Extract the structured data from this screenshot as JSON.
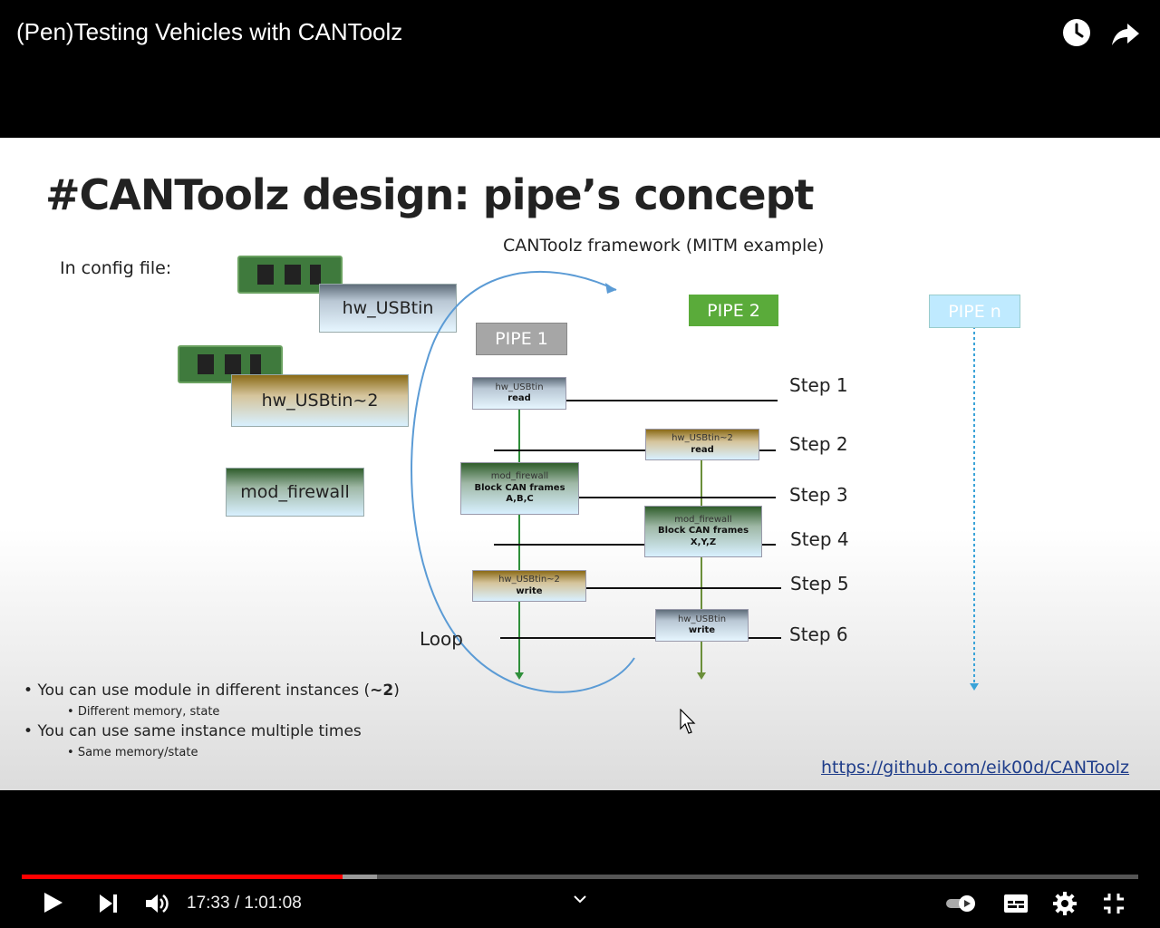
{
  "video": {
    "title": "(Pen)Testing Vehicles with CANToolz",
    "current_time": "17:33",
    "separator": " / ",
    "duration": "1:01:08",
    "played_fraction": 0.287,
    "buffered_fraction": 0.318
  },
  "top_icons": [
    "watch-later-icon",
    "share-icon"
  ],
  "slide": {
    "title": "#CANToolz design: pipe’s concept",
    "config_label": "In config file:",
    "framework_label": "CANToolz framework (MITM example)",
    "config_modules": [
      "hw_USBtin",
      "hw_USBtin~2",
      "mod_firewall"
    ],
    "pipes": [
      "PIPE 1",
      "PIPE 2",
      "PIPE n"
    ],
    "pipe1_modules": [
      {
        "name": "hw_USBtin",
        "action": "read"
      },
      {
        "name": "mod_firewall",
        "action": "Block CAN frames",
        "extra": "A,B,C"
      },
      {
        "name": "hw_USBtin~2",
        "action": "write"
      }
    ],
    "pipe2_modules": [
      {
        "name": "hw_USBtin~2",
        "action": "read"
      },
      {
        "name": "mod_firewall",
        "action": "Block CAN frames",
        "extra": "X,Y,Z"
      },
      {
        "name": "hw_USBtin",
        "action": "write"
      }
    ],
    "steps": [
      "Step 1",
      "Step 2",
      "Step 3",
      "Step 4",
      "Step 5",
      "Step 6"
    ],
    "loop_label": "Loop",
    "bullets": [
      {
        "prefix": "You can use module in different instances (",
        "bold": "~2",
        "suffix": ")",
        "sub": "Different memory, state"
      },
      {
        "text": "You can use same instance multiple times",
        "sub": "Same memory/state"
      }
    ],
    "link": "https://github.com/eik00d/CANToolz"
  },
  "colors": {
    "progress_played": "#ff0000",
    "pipe1": "#a6a6a6",
    "pipe2": "#5aab3a",
    "pipen": "#bfeaff"
  }
}
